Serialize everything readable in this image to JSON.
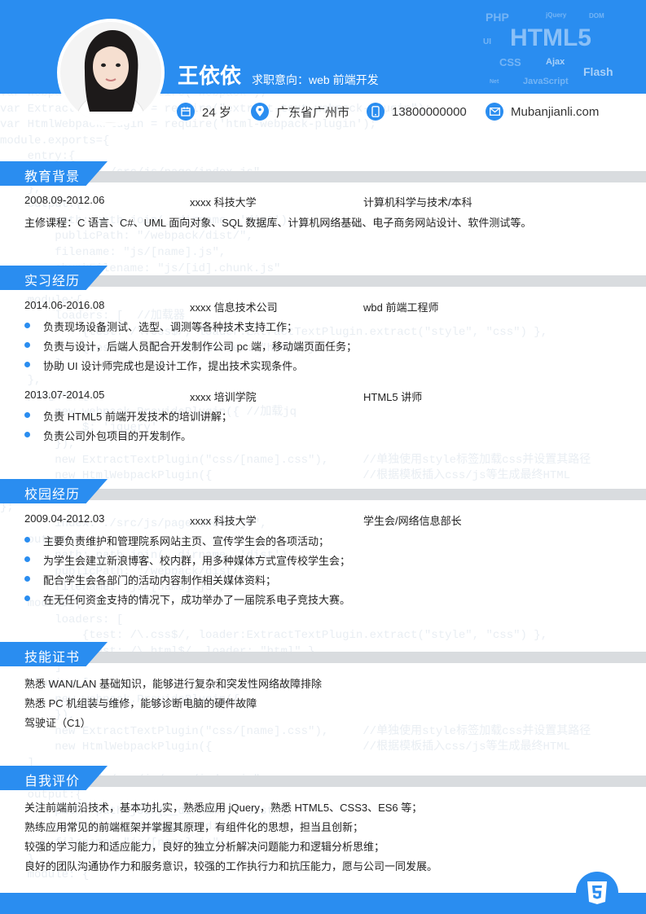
{
  "header": {
    "name": "王依依",
    "intent": "求职意向：web 前端开发",
    "tech_words": [
      "PHP",
      "jQuery",
      "DOM",
      "HTML5",
      "UI",
      "CSS",
      "Ajax",
      "Flash",
      "Net",
      "JavaScript"
    ]
  },
  "info": {
    "age": "24 岁",
    "location": "广东省广州市",
    "phone": "13800000000",
    "website": "Mubanjianli.com"
  },
  "sections": {
    "education": "教育背景",
    "internship": "实习经历",
    "campus": "校园经历",
    "skills": "技能证书",
    "self": "自我评价"
  },
  "education": {
    "period": "2008.09-2012.06",
    "school": "xxxx 科技大学",
    "major": "计算机科学与技术/本科",
    "courses": "主修课程：C 语言、C#、UML 面向对象、SQL 数据库、计算机网络基础、电子商务网站设计、软件测试等。"
  },
  "internships": [
    {
      "period": "2014.06-2016.08",
      "org": "xxxx 信息技术公司",
      "role": "wbd 前端工程师",
      "items": [
        "负责现场设备测试、选型、调测等各种技术支持工作；",
        "负责与设计，后端人员配合开发制作公司 pc 端，移动端页面任务；",
        "协助 UI 设计师完成也是设计工作，提出技术实现条件。"
      ]
    },
    {
      "period": "2013.07-2014.05",
      "org": "xxxx 培训学院",
      "role": "HTML5 讲师",
      "items": [
        "负责 HTML5 前端开发技术的培训讲解；",
        "负责公司外包项目的开发制作。"
      ]
    }
  ],
  "campus": {
    "period": "2009.04-2012.03",
    "org": "xxxx 科技大学",
    "role": "学生会/网络信息部长",
    "items": [
      "主要负责维护和管理院系网站主页、宣传学生会的各项活动；",
      "为学生会建立新浪博客、校内群，用多种媒体方式宣传校学生会；",
      "配合学生会各部门的活动内容制作相关媒体资料；",
      "在无任何资金支持的情况下，成功举办了一届院系电子竞技大赛。"
    ]
  },
  "skills": [
    "熟悉 WAN/LAN 基础知识，能够进行复杂和突发性网络故障排除",
    "熟悉 PC 机组装与维修，能够诊断电脑的硬件故障",
    "驾驶证（C1）"
  ],
  "self_eval": [
    "关注前端前沿技术，基本功扎实，熟悉应用 jQuery，熟悉 HTML5、CSS3、ES6 等；",
    "熟练应用常见的前端框架并掌握其原理，有组件化的思想，担当且创新；",
    "较强的学习能力和适应能力，良好的独立分析解决问题能力和逻辑分析思维；",
    "良好的团队沟通协作力和服务意识，较强的工作执行力和抗压能力，愿与公司一同发展。"
  ],
  "colors": {
    "accent": "#2a8df0",
    "band_gray": "#d9dcdf"
  }
}
